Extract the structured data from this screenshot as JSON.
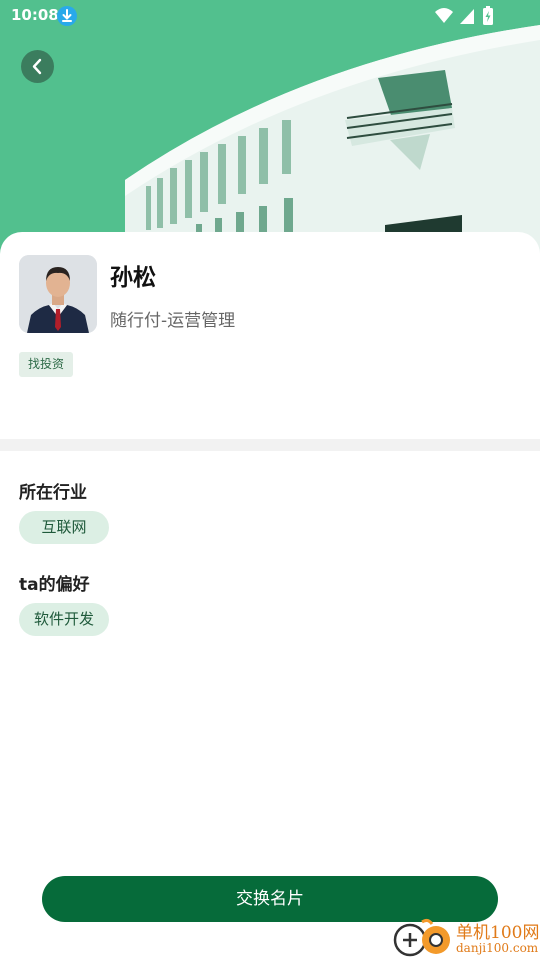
{
  "status_bar": {
    "time": "10:08",
    "icons": [
      "download-notification-icon",
      "wifi-icon",
      "cellular-signal-icon",
      "battery-charging-icon"
    ]
  },
  "header": {
    "back_icon": "chevron-left-icon",
    "banner": "building-photo"
  },
  "profile": {
    "name": "孙松",
    "company_role": "随行付-运营管理",
    "tags": [
      "找投资"
    ]
  },
  "sections": {
    "industry": {
      "title": "所在行业",
      "items": [
        "互联网"
      ]
    },
    "preference": {
      "title": "ta的偏好",
      "items": [
        "软件开发"
      ]
    }
  },
  "actions": {
    "exchange_card_label": "交换名片"
  },
  "watermark": {
    "line1": "单机100网",
    "line2": "danji100.com"
  },
  "colors": {
    "primary": "#066b3a",
    "hero_green": "#52c08e",
    "pill_bg": "#dcefe4",
    "watermark_orange": "#e07a18"
  }
}
